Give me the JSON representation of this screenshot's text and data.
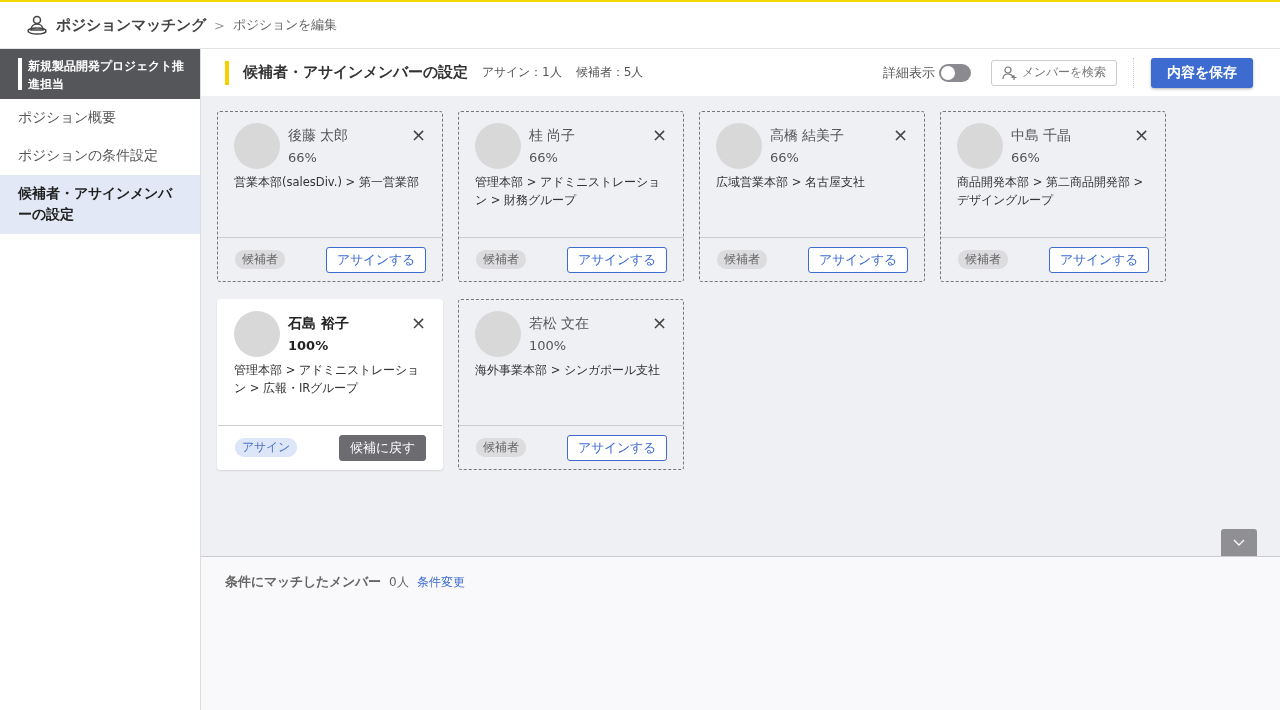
{
  "breadcrumb": {
    "app": "ポジションマッチング",
    "separator": ">",
    "page": "ポジションを編集"
  },
  "sidebar": {
    "title": "新規製品開発プロジェクト推進担当",
    "items": [
      {
        "label": "ポジション概要",
        "selected": false
      },
      {
        "label": "ポジションの条件設定",
        "selected": false
      },
      {
        "label": "候補者・アサインメンバーの設定",
        "selected": true
      }
    ]
  },
  "header": {
    "title": "候補者・アサインメンバーの設定",
    "assign_count": "アサイン：1人",
    "candidate_count": "候補者：5人",
    "detail_toggle": {
      "label": "詳細表示",
      "on": false
    },
    "search_button": "メンバーを検索",
    "save_button": "内容を保存"
  },
  "cards": [
    {
      "kind": "candidate",
      "name": "後藤 太郎",
      "match": "66%",
      "department": "営業本部(salesDiv.) > 第一営業部",
      "status": "候補者",
      "action": "アサインする",
      "close": "×"
    },
    {
      "kind": "candidate",
      "name": "桂 尚子",
      "match": "66%",
      "department": "管理本部 > アドミニストレーション > 財務グループ",
      "status": "候補者",
      "action": "アサインする",
      "close": "×"
    },
    {
      "kind": "candidate",
      "name": "高橋 結美子",
      "match": "66%",
      "department": "広域営業本部 > 名古屋支社",
      "status": "候補者",
      "action": "アサインする",
      "close": "×"
    },
    {
      "kind": "candidate",
      "name": "中島 千晶",
      "match": "66%",
      "department": "商品開発本部 > 第二商品開発部 > デザイングループ",
      "status": "候補者",
      "action": "アサインする",
      "close": "×"
    },
    {
      "kind": "assigned",
      "name": "石島 裕子",
      "match": "100%",
      "department": "管理本部 > アドミニストレーション > 広報・IRグループ",
      "status": "アサイン",
      "action": "候補に戻す",
      "close": "×"
    },
    {
      "kind": "candidate",
      "name": "若松 文在",
      "match": "100%",
      "department": "海外事業本部 > シンガポール支社",
      "status": "候補者",
      "action": "アサインする",
      "close": "×"
    }
  ],
  "matched": {
    "title": "条件にマッチしたメンバー",
    "count": "0人",
    "link": "条件変更"
  }
}
